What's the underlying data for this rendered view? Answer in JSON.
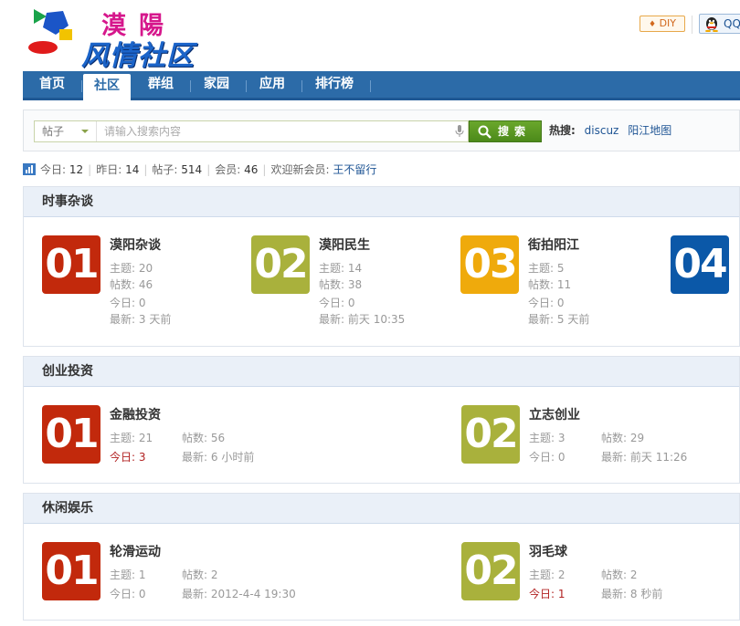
{
  "header": {
    "logo_top": "漠陽",
    "logo_bottom": "风情社区",
    "diy_label": "DIY",
    "qq_label": "QQ"
  },
  "nav": {
    "items": [
      {
        "label": "首页"
      },
      {
        "label": "社区"
      },
      {
        "label": "群组"
      },
      {
        "label": "家园"
      },
      {
        "label": "应用"
      },
      {
        "label": "排行榜"
      }
    ]
  },
  "search": {
    "type": "帖子",
    "placeholder": "请输入搜索内容",
    "button": "搜索",
    "hot_label": "热搜:",
    "hot_links": [
      "discuz",
      "阳江地图"
    ]
  },
  "stats": {
    "today_label": "今日:",
    "today": "12",
    "yesterday_label": "昨日:",
    "yesterday": "14",
    "posts_label": "帖子:",
    "posts": "514",
    "members_label": "会员:",
    "members": "46",
    "welcome_label": "欢迎新会员:",
    "newest_member": "王不留行"
  },
  "colors": {
    "red": "#c2290c",
    "olive": "#a9b13c",
    "orange": "#efaa0c",
    "blue": "#0b58a8"
  },
  "sections": [
    {
      "title": "时事杂谈",
      "forums": [
        {
          "num": "01",
          "title": "漠阳杂谈",
          "topics_label": "主题:",
          "topics": "20",
          "posts_label": "帖数:",
          "posts": "46",
          "today_label": "今日:",
          "today": "0",
          "latest_label": "最新:",
          "latest": "3 天前"
        },
        {
          "num": "02",
          "title": "漠阳民生",
          "topics_label": "主题:",
          "topics": "14",
          "posts_label": "帖数:",
          "posts": "38",
          "today_label": "今日:",
          "today": "0",
          "latest_label": "最新:",
          "latest": "前天 10:35"
        },
        {
          "num": "03",
          "title": "街拍阳江",
          "topics_label": "主题:",
          "topics": "5",
          "posts_label": "帖数:",
          "posts": "11",
          "today_label": "今日:",
          "today": "0",
          "latest_label": "最新:",
          "latest": "5 天前"
        },
        {
          "num": "04"
        }
      ]
    },
    {
      "title": "创业投资",
      "forums": [
        {
          "num": "01",
          "title": "金融投资",
          "topics_label": "主题:",
          "topics": "21",
          "posts_label": "帖数:",
          "posts": "56",
          "today_label": "今日:",
          "today": "3",
          "latest_label": "最新:",
          "latest": "6 小时前"
        },
        {
          "num": "02",
          "title": "立志创业",
          "topics_label": "主题:",
          "topics": "3",
          "posts_label": "帖数:",
          "posts": "29",
          "today_label": "今日:",
          "today": "0",
          "latest_label": "最新:",
          "latest": "前天 11:26"
        }
      ]
    },
    {
      "title": "休闲娱乐",
      "forums": [
        {
          "num": "01",
          "title": "轮滑运动",
          "topics_label": "主题:",
          "topics": "1",
          "posts_label": "帖数:",
          "posts": "2",
          "today_label": "今日:",
          "today": "0",
          "latest_label": "最新:",
          "latest": "2012-4-4 19:30"
        },
        {
          "num": "02",
          "title": "羽毛球",
          "topics_label": "主题:",
          "topics": "2",
          "posts_label": "帖数:",
          "posts": "2",
          "today_label": "今日:",
          "today": "1",
          "latest_label": "最新:",
          "latest": "8 秒前"
        }
      ]
    }
  ]
}
